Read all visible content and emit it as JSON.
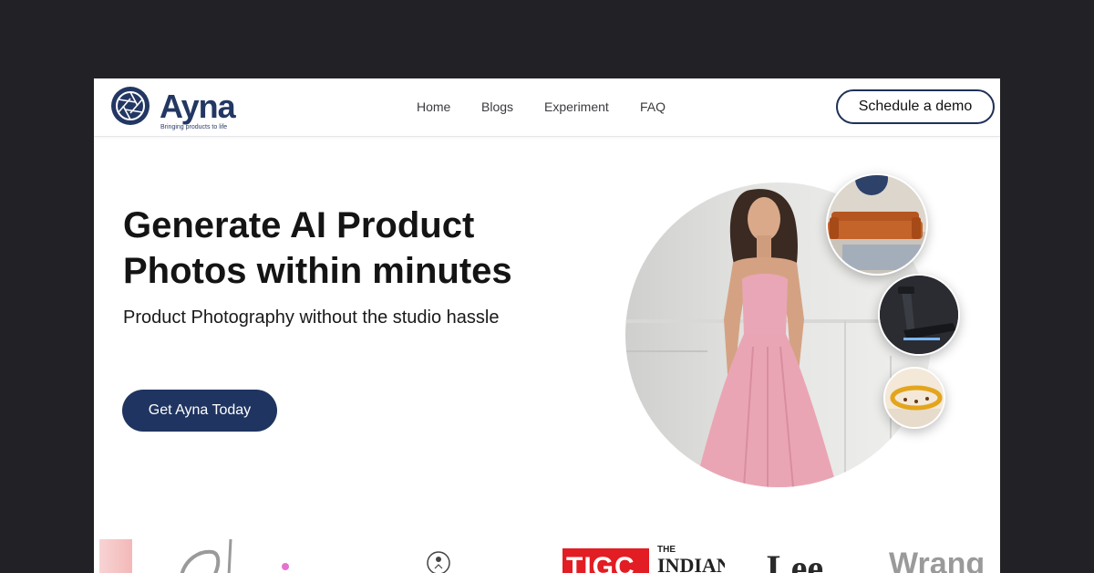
{
  "brand": {
    "name": "Ayna",
    "tagline": "Bringing products to life",
    "color": "#233763"
  },
  "nav": [
    {
      "label": "Home"
    },
    {
      "label": "Blogs"
    },
    {
      "label": "Experiment"
    },
    {
      "label": "FAQ"
    }
  ],
  "header": {
    "demo_label": "Schedule a demo"
  },
  "hero": {
    "title_line1": "Generate AI Product",
    "title_line2": "Photos within minutes",
    "subtitle": "Product Photography without the studio hassle",
    "cta_label": "Get Ayna Today",
    "accent": "#1f3460"
  },
  "logos": {
    "tigc": "TIGC",
    "the": "THE",
    "indian": "INDIAN",
    "lee": "Lee",
    "wrangler": "Wrang"
  }
}
